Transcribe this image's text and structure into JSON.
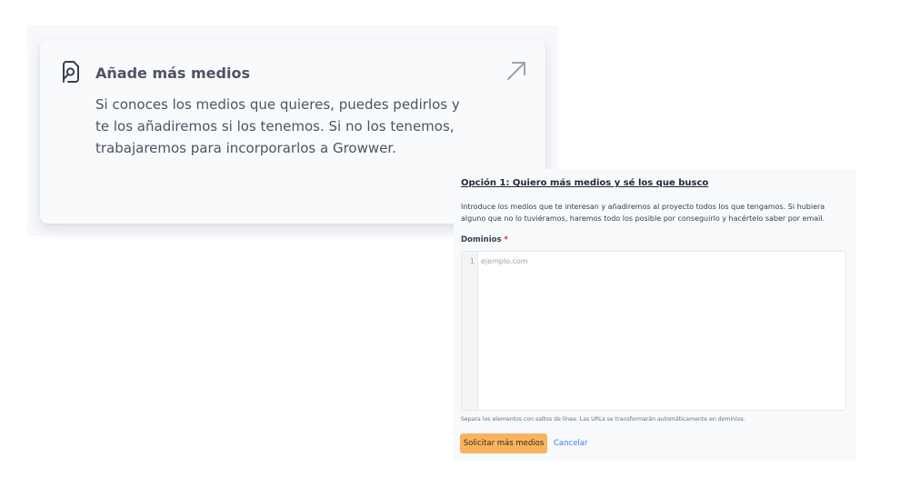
{
  "card": {
    "title": "Añade más medios",
    "description": "Si conoces los medios que quieres, puedes pedirlos y te los añadiremos si los tenemos. Si no los tenemos, trabajaremos para incorporarlos a Growwer.",
    "icon": "document-search-icon",
    "action_icon": "arrow-up-right-icon"
  },
  "form": {
    "title": "Opción 1: Quiero más medios y sé los que busco",
    "description": "Introduce los medios que te interesan y añadiremos al proyecto todos los que tengamos. Si hubiera alguno que no lo tuviéramos, haremos todo los posible por conseguirlo y hacértelo saber por email.",
    "field_label": "Dominios",
    "required_mark": "*",
    "line_number": "1",
    "placeholder": "ejemplo.com",
    "value": "",
    "help_text": "Separa los elementos con saltos de línea. Las URLs se transformarán automáticamente en dominios.",
    "submit_label": "Solicitar más medios",
    "cancel_label": "Cancelar"
  },
  "colors": {
    "submit_button": "#f9b35f",
    "cancel_link": "#3b82f6",
    "required": "#dc2626",
    "card_text": "#4b5563"
  }
}
